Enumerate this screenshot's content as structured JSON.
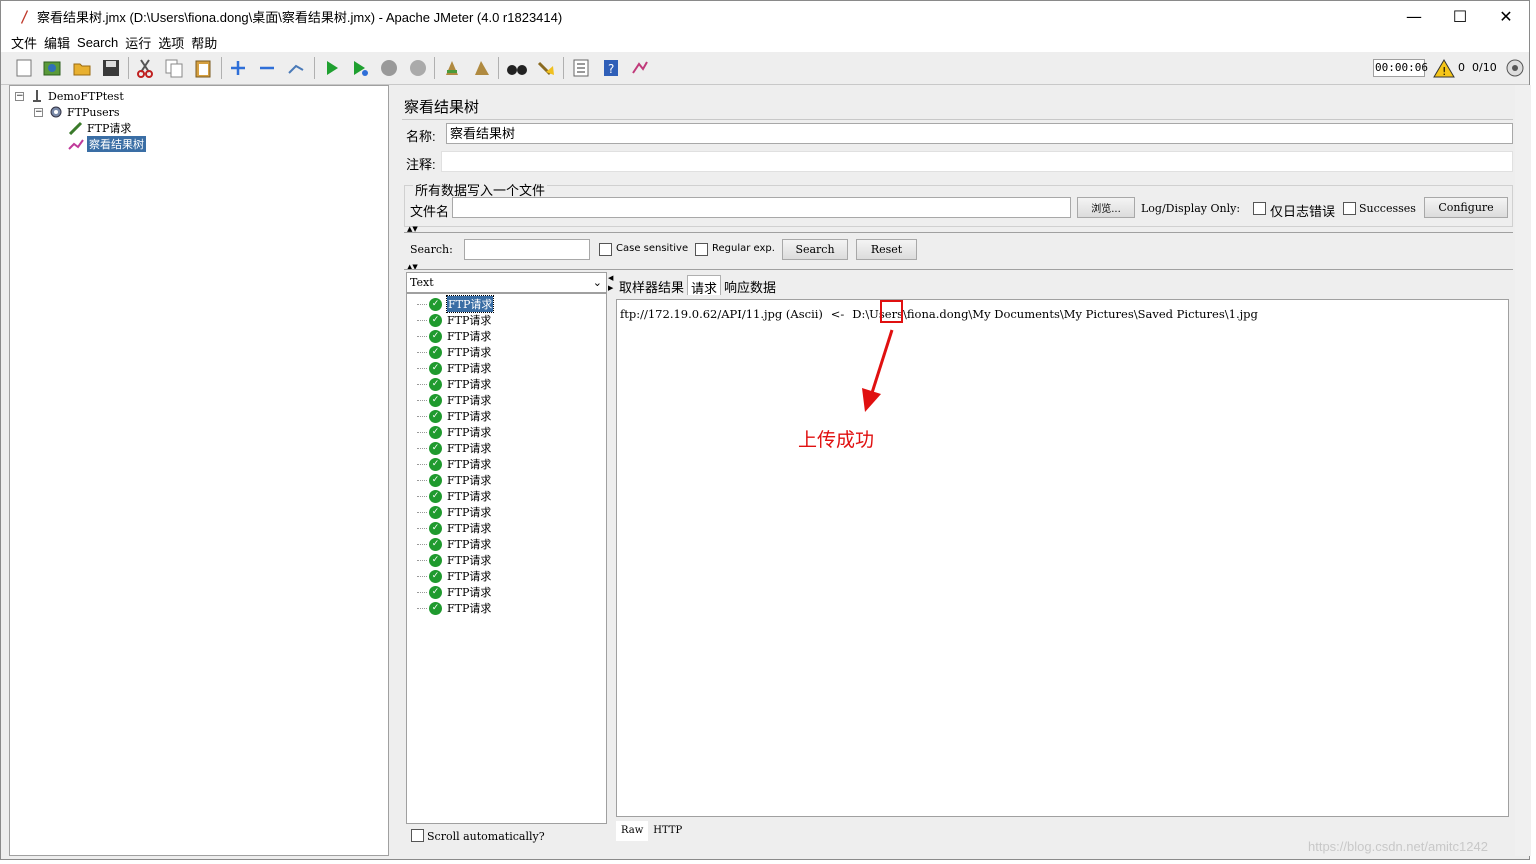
{
  "window": {
    "title": "察看结果树.jmx (D:\\Users\\fiona.dong\\桌面\\察看结果树.jmx) - Apache JMeter (4.0 r1823414)",
    "controls": [
      "—",
      "☐",
      "✕"
    ]
  },
  "menu": [
    "文件",
    "编辑",
    "Search",
    "运行",
    "选项",
    "帮助"
  ],
  "toolbar": {
    "timer": "00:00:06",
    "warning_count": "0",
    "thread_count": "0/10"
  },
  "tree": {
    "root": "DemoFTPtest",
    "thread_group": "FTPusers",
    "sampler": "FTP请求",
    "listener": "察看结果树"
  },
  "panel": {
    "title": "察看结果树",
    "name_label": "名称:",
    "name_value": "察看结果树",
    "comment_label": "注释:",
    "comment_value": "",
    "file_group_title": "所有数据写入一个文件",
    "filename_label": "文件名",
    "filename_value": "",
    "browse_button": "浏览...",
    "log_display_label": "Log/Display Only:",
    "errors_only_label": "仅日志错误",
    "successes_label": "Successes",
    "configure_button": "Configure"
  },
  "search": {
    "label": "Search:",
    "value": "",
    "case_sensitive_label": "Case sensitive",
    "regex_label": "Regular exp.",
    "search_button": "Search",
    "reset_button": "Reset"
  },
  "results": {
    "renderer": "Text",
    "items": [
      "FTP请求",
      "FTP请求",
      "FTP请求",
      "FTP请求",
      "FTP请求",
      "FTP请求",
      "FTP请求",
      "FTP请求",
      "FTP请求",
      "FTP请求",
      "FTP请求",
      "FTP请求",
      "FTP请求",
      "FTP请求",
      "FTP请求",
      "FTP请求",
      "FTP请求",
      "FTP请求",
      "FTP请求",
      "FTP请求"
    ],
    "scroll_label": "Scroll automatically?",
    "status_color": "#1f9a2e"
  },
  "detail": {
    "tabs": [
      "取样器结果",
      "请求",
      "响应数据"
    ],
    "active_tab": "请求",
    "request_text_before": "ftp://172.19.0.62/API/11.jpg (Ascii) ",
    "request_arrow": "<-",
    "request_text_after": " D:\\Users\\fiona.dong\\My Documents\\My Pictures\\Saved Pictures\\1.jpg",
    "annotation": "上传成功",
    "annotation_color": "#e01010",
    "bottom_tabs": [
      "Raw",
      "HTTP"
    ]
  },
  "watermark": "https://blog.csdn.net/amitc1242"
}
